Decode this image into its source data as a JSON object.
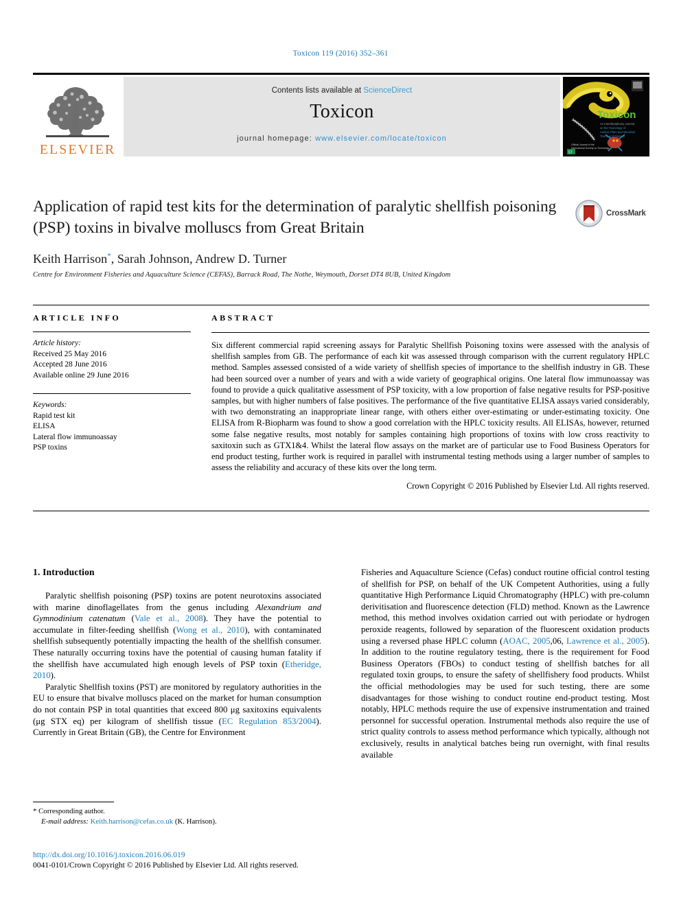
{
  "running_head": "Toxicon 119 (2016) 352–361",
  "masthead": {
    "publisher_name": "ELSEVIER",
    "contents_prefix": "Contents lists available at ",
    "contents_link": "ScienceDirect",
    "journal_name": "Toxicon",
    "homepage_prefix": "journal homepage: ",
    "homepage_url": "www.elsevier.com/locate/toxicon",
    "cover_journal_title": "Toxicon"
  },
  "article": {
    "title": "Application of rapid test kits for the determination of paralytic shellfish poisoning (PSP) toxins in bivalve molluscs from Great Britain",
    "authors": "Keith Harrison*, Sarah Johnson, Andrew D. Turner",
    "affiliation": "Centre for Environment Fisheries and Aquaculture Science (CEFAS), Barrack Road, The Nothe, Weymouth, Dorset DT4 8UB, United Kingdom",
    "crossmark_label": "CrossMark"
  },
  "article_info": {
    "heading": "ARTICLE INFO",
    "history_label": "Article history:",
    "history": [
      "Received 25 May 2016",
      "Accepted 28 June 2016",
      "Available online 29 June 2016"
    ],
    "keywords_label": "Keywords:",
    "keywords": [
      "Rapid test kit",
      "ELISA",
      "Lateral flow immunoassay",
      "PSP toxins"
    ]
  },
  "abstract": {
    "heading": "ABSTRACT",
    "text": "Six different commercial rapid screening assays for Paralytic Shellfish Poisoning toxins were assessed with the analysis of shellfish samples from GB. The performance of each kit was assessed through comparison with the current regulatory HPLC method. Samples assessed consisted of a wide variety of shellfish species of importance to the shellfish industry in GB. These had been sourced over a number of years and with a wide variety of geographical origins. One lateral flow immunoassay was found to provide a quick qualitative assessment of PSP toxicity, with a low proportion of false negative results for PSP-positive samples, but with higher numbers of false positives. The performance of the five quantitative ELISA assays varied considerably, with two demonstrating an inappropriate linear range, with others either over-estimating or under-estimating toxicity. One ELISA from R-Biopharm was found to show a good correlation with the HPLC toxicity results. All ELISAs, however, returned some false negative results, most notably for samples containing high proportions of toxins with low cross reactivity to saxitoxin such as GTX1&4. Whilst the lateral flow assays on the market are of particular use to Food Business Operators for end product testing, further work is required in parallel with instrumental testing methods using a larger number of samples to assess the reliability and accuracy of these kits over the long term.",
    "copyright": "Crown Copyright © 2016 Published by Elsevier Ltd. All rights reserved."
  },
  "introduction": {
    "heading": "1. Introduction",
    "left_para_1_a": "Paralytic shellfish poisoning (PSP) toxins are potent neurotoxins associated with marine dinoflagellates from the genus including ",
    "left_para_1_italic": "Alexandrium and Gymnodinium catenatum",
    "left_para_1_ref1": "Vale et al., 2008",
    "left_para_1_b": "). They have the potential to accumulate in filter-feeding shellfish (",
    "left_para_1_ref2": "Wong et al., 2010",
    "left_para_1_c": "), with contaminated shellfish subsequently potentially impacting the health of the shellfish consumer. These naturally occurring toxins have the potential of causing human fatality if the shellfish have accumulated high enough levels of PSP toxin (",
    "left_para_1_ref3": "Etheridge, 2010",
    "left_para_1_d": ").",
    "left_para_2_a": "Paralytic Shellfish toxins (PST) are monitored by regulatory authorities in the EU to ensure that bivalve molluscs placed on the market for human consumption do not contain PSP in total quantities that exceed 800 μg saxitoxins equivalents (μg STX eq) per kilogram of shellfish tissue (",
    "left_para_2_ref1": "EC Regulation 853/2004",
    "left_para_2_b": "). Currently in Great Britain (GB), the Centre for Environment",
    "right_para_a": "Fisheries and Aquaculture Science (Cefas) conduct routine official control testing of shellfish for PSP, on behalf of the UK Competent Authorities, using a fully quantitative High Performance Liquid Chromatography (HPLC) with pre-column derivitisation and fluorescence detection (FLD) method. Known as the Lawrence method, this method involves oxidation carried out with periodate or hydrogen peroxide reagents, followed by separation of the fluorescent oxidation products using a reversed phase HPLC column (",
    "right_para_ref1": "AOAC, 2005",
    "right_para_b": ",06, ",
    "right_para_ref2": "Lawrence et al., 2005",
    "right_para_c": "). In addition to the routine regulatory testing, there is the requirement for Food Business Operators (FBOs) to conduct testing of shellfish batches for all regulated toxin groups, to ensure the safety of shellfishery food products. Whilst the official methodologies may be used for such testing, there are some disadvantages for those wishing to conduct routine end-product testing. Most notably, HPLC methods require the use of expensive instrumentation and trained personnel for successful operation. Instrumental methods also require the use of strict quality controls to assess method performance which typically, although not exclusively, results in analytical batches being run overnight, with final results available"
  },
  "footnote": {
    "corresponding_marker": "*",
    "corresponding_text": "Corresponding author.",
    "email_label": "E-mail address:",
    "email": "Keith.harrison@cefas.co.uk",
    "email_suffix": "(K. Harrison)."
  },
  "footer": {
    "doi_url": "http://dx.doi.org/10.1016/j.toxicon.2016.06.019",
    "issn_copyright": "0041-0101/Crown Copyright © 2016 Published by Elsevier Ltd. All rights reserved."
  },
  "colors": {
    "link_blue": "#1a7bb9",
    "sciencedirect_blue": "#3a9fd4",
    "elsevier_orange": "#E87722",
    "band_gray": "#e4e4e4"
  }
}
